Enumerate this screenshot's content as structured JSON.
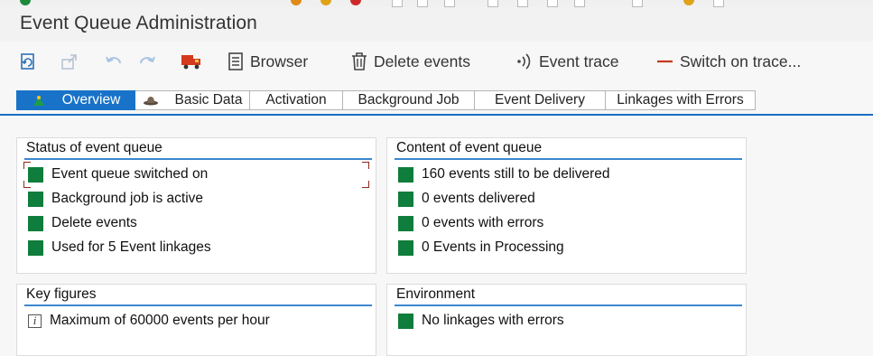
{
  "app": {
    "title": "Event Queue Administration"
  },
  "toolbar": {
    "refresh_icon": "refresh-icon",
    "export_icon": "export-icon",
    "undo_icon": "undo-icon",
    "redo_icon": "redo-icon",
    "truck_icon": "delivery-truck-icon",
    "browser_label": "Browser",
    "delete_events_label": "Delete events",
    "event_trace_label": "Event trace",
    "switch_on_trace_label": "Switch on trace..."
  },
  "tabs": [
    {
      "label": "Overview",
      "icon": "overview-icon",
      "active": true
    },
    {
      "label": "Basic Data",
      "icon": "hat-icon"
    },
    {
      "label": "Activation"
    },
    {
      "label": "Background Job"
    },
    {
      "label": "Event Delivery"
    },
    {
      "label": "Linkages with Errors"
    }
  ],
  "status": {
    "title": "Status of event queue",
    "items": [
      "Event queue switched on",
      "Background job is active",
      "Delete events",
      "Used for 5 Event linkages"
    ]
  },
  "content": {
    "title": "Content of event queue",
    "items": [
      "160 events still to be delivered",
      "0 events delivered",
      "0 events with errors",
      "0 Events in Processing"
    ]
  },
  "key_figures": {
    "title": "Key figures",
    "items": [
      "Maximum of 60000 events per hour"
    ]
  },
  "environment": {
    "title": "Environment",
    "items": [
      "No linkages with errors"
    ]
  },
  "colors": {
    "accent": "#1873c8",
    "status_green": "#0f7d3b",
    "trace_red": "#c43a1c"
  }
}
